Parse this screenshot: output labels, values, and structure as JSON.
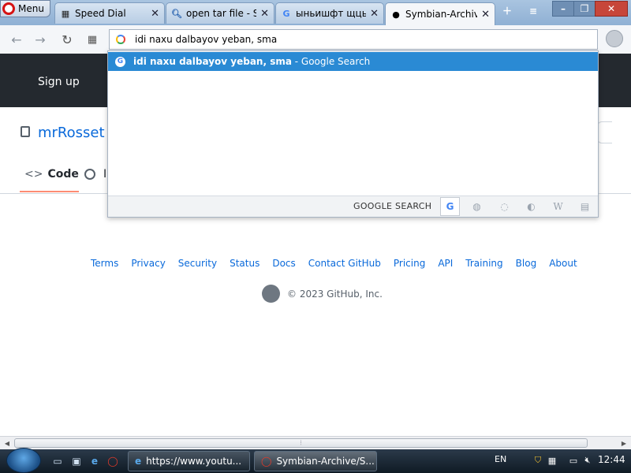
{
  "browser": {
    "menu_label": "Menu",
    "tabs": [
      {
        "label": "Speed Dial",
        "icon": "grid-icon"
      },
      {
        "label": "open tar file - Se",
        "icon": "search-icon"
      },
      {
        "label": "ыньишфт щцы:",
        "icon": "google-icon"
      },
      {
        "label": "Symbian-Archiv",
        "icon": "github-icon"
      }
    ],
    "address_text": "idi naxu dalbayov yeban, sma"
  },
  "dropdown": {
    "suggestion_query": "idi naxu dalbayov yeban, sma",
    "suggestion_suffix": " - Google Search",
    "search_button": "GOOGLE SEARCH",
    "engines": [
      "google",
      "amazon",
      "yandex",
      "duckduckgo",
      "wikipedia",
      "dictionary"
    ],
    "wiki_glyph": "W"
  },
  "page": {
    "signup": "Sign up",
    "repo_owner": "mrRosset /",
    "code_tab": "Code",
    "code_glyph": "<>",
    "issues_frag": "I",
    "footer_links": [
      "Terms",
      "Privacy",
      "Security",
      "Status",
      "Docs",
      "Contact GitHub",
      "Pricing",
      "API",
      "Training",
      "Blog",
      "About"
    ],
    "copyright": "© 2023 GitHub, Inc."
  },
  "taskbar": {
    "tasks": [
      "https://www.youtu...",
      "Symbian-Archive/S..."
    ],
    "lang": "EN",
    "clock": "12:44"
  }
}
